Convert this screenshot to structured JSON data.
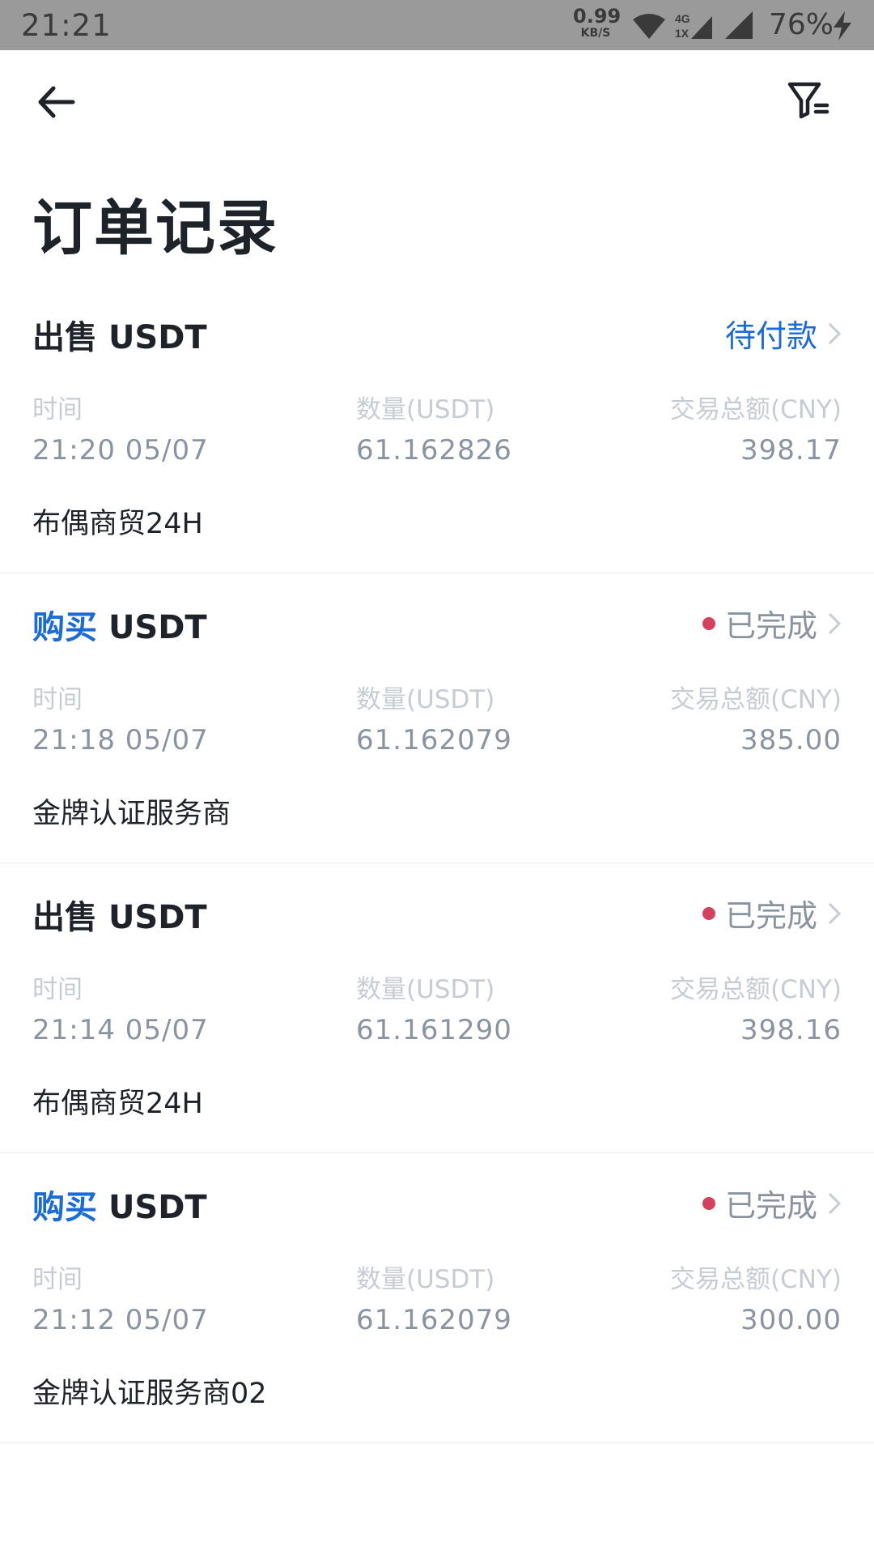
{
  "status_bar": {
    "time": "21:21",
    "net_speed_value": "0.99",
    "net_speed_unit": "KB/S",
    "net_type_top": "4G",
    "net_type_bottom": "1X",
    "battery": "76%"
  },
  "page": {
    "title": "订单记录"
  },
  "labels": {
    "time": "时间",
    "amount": "数量(USDT)",
    "total": "交易总额(CNY)"
  },
  "colors": {
    "accent_blue": "#1b6bd6",
    "status_dot": "#d4405d",
    "text_primary": "#1e2329",
    "text_secondary": "#8a94a0"
  },
  "orders": [
    {
      "action": "出售",
      "asset": "USDT",
      "status": "待付款",
      "time": "21:20 05/07",
      "amount": "61.162826",
      "total": "398.17",
      "merchant": "布偶商贸24H"
    },
    {
      "action": "购买",
      "asset": "USDT",
      "status": "已完成",
      "time": "21:18 05/07",
      "amount": "61.162079",
      "total": "385.00",
      "merchant": "金牌认证服务商"
    },
    {
      "action": "出售",
      "asset": "USDT",
      "status": "已完成",
      "time": "21:14 05/07",
      "amount": "61.161290",
      "total": "398.16",
      "merchant": "布偶商贸24H"
    },
    {
      "action": "购买",
      "asset": "USDT",
      "status": "已完成",
      "time": "21:12 05/07",
      "amount": "61.162079",
      "total": "300.00",
      "merchant": "金牌认证服务商02"
    }
  ]
}
